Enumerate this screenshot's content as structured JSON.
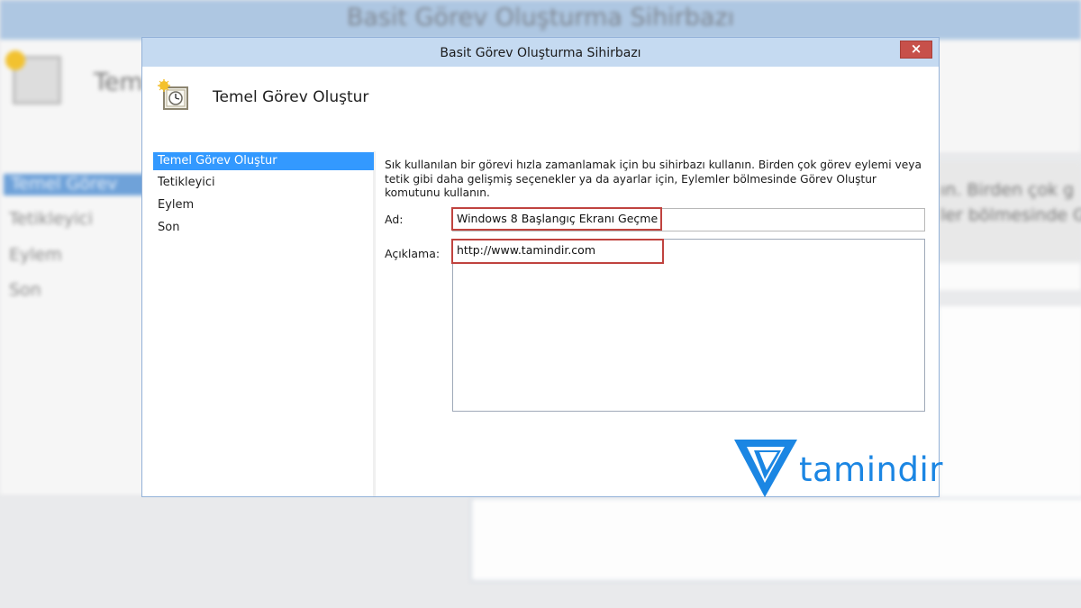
{
  "dialog": {
    "title": "Basit Görev Oluşturma Sihirbazı",
    "close_label": "×",
    "heading": "Temel Görev Oluştur",
    "heading_icon": "task-scheduler-clock-icon"
  },
  "sidebar": {
    "items": [
      {
        "label": "Temel Görev Oluştur",
        "selected": true
      },
      {
        "label": "Tetikleyici",
        "selected": false
      },
      {
        "label": "Eylem",
        "selected": false
      },
      {
        "label": "Son",
        "selected": false
      }
    ]
  },
  "content": {
    "intro": "Sık kullanılan bir görevi hızla zamanlamak için bu sihirbazı kullanın. Birden çok görev eylemi veya tetik gibi daha gelişmiş seçenekler ya da ayarlar için, Eylemler bölmesinde Görev Oluştur komutunu kullanın.",
    "name_label": "Ad:",
    "name_value": "Windows 8 Başlangıç Ekranı Geçme",
    "description_label": "Açıklama:",
    "description_value": "http://www.tamindir.com"
  },
  "background": {
    "title": "Basit Görev Oluşturma Sihirbazı",
    "heading": "Tem",
    "sidebar_items": [
      "Temel Görev",
      "Tetikleyici",
      "Eylem",
      "Son"
    ],
    "right_text_1": "ın. Birden çok g",
    "right_text_2": "ler bölmesinde G"
  },
  "logo": {
    "text": "tamindir",
    "color": "#1b86e3"
  },
  "colors": {
    "highlight_border": "#c0433f",
    "selection": "#3399ff",
    "titlebar": "#c5daf1",
    "close_button": "#c7504a"
  }
}
